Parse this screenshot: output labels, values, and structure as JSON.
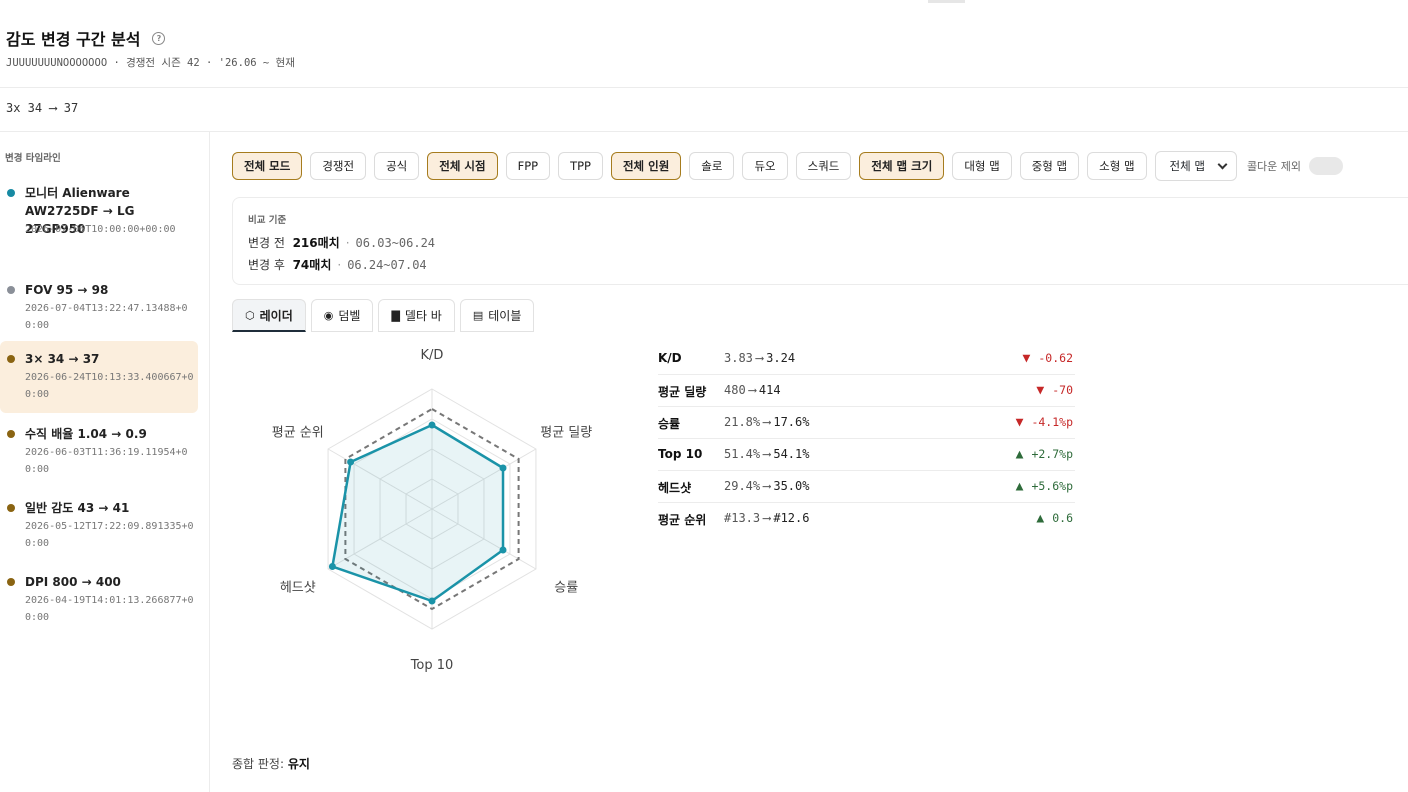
{
  "header": {
    "title": "감도 변경 구간 분석",
    "help_icon": "?",
    "subtitle": "JUUUUUUUNOOOOOOO · 경쟁전 시즌 42 · '26.06 ~ 현재"
  },
  "current": {
    "text": "3x 34 ⟶ 37"
  },
  "sidebar": {
    "title": "변경 타임라인",
    "items": [
      {
        "label": "모니터 Alienware AW2725DF → LG 27GP950",
        "timestamp": "2026-07-06T10:00:00+00:00",
        "color": "#178aa3"
      },
      {
        "label": "FOV 95 → 98",
        "timestamp": "2026-07-04T13:22:47.13488+00:00",
        "color": "#8a8f98"
      },
      {
        "label": "3× 34 → 37",
        "timestamp": "2026-06-24T10:13:33.400667+00:00",
        "color": "#8a6412",
        "active": true
      },
      {
        "label": "수직 배율 1.04 → 0.9",
        "timestamp": "2026-06-03T11:36:19.11954+00:00",
        "color": "#8a6412"
      },
      {
        "label": "일반 감도 43 → 41",
        "timestamp": "2026-05-12T17:22:09.891335+00:00",
        "color": "#8a6412"
      },
      {
        "label": "DPI 800 → 400",
        "timestamp": "2026-04-19T14:01:13.266877+00:00",
        "color": "#8a6412"
      }
    ]
  },
  "filters": {
    "chips": [
      {
        "label": "전체 모드",
        "on": true
      },
      {
        "label": "경쟁전",
        "on": false
      },
      {
        "label": "공식",
        "on": false
      },
      {
        "label": "전체 시점",
        "on": true
      },
      {
        "label": "FPP",
        "on": false
      },
      {
        "label": "TPP",
        "on": false
      },
      {
        "label": "전체 인원",
        "on": true
      },
      {
        "label": "솔로",
        "on": false
      },
      {
        "label": "듀오",
        "on": false
      },
      {
        "label": "스쿼드",
        "on": false
      },
      {
        "label": "전체 맵 크기",
        "on": true
      },
      {
        "label": "대형 맵",
        "on": false
      },
      {
        "label": "중형 맵",
        "on": false
      },
      {
        "label": "소형 맵",
        "on": false
      }
    ],
    "map_select": "전체 맵",
    "toggle_label": "콜다운 제외"
  },
  "baseline": {
    "title": "비교 기준",
    "before_label": "변경 전",
    "before_matches": "216매치",
    "before_range": "06.03~06.24",
    "after_label": "변경 후",
    "after_matches": "74매치",
    "after_range": "06.24~07.04"
  },
  "tabs": [
    {
      "label": "레이더",
      "icon": "hexagon-icon",
      "on": true
    },
    {
      "label": "덤벨",
      "icon": "dumbbell-icon",
      "on": false
    },
    {
      "label": "델타 바",
      "icon": "bar-icon",
      "on": false
    },
    {
      "label": "테이블",
      "icon": "table-icon",
      "on": false
    }
  ],
  "chart_data": {
    "type": "radar",
    "axes": [
      "K/D",
      "평균 딜량",
      "승률",
      "Top 10",
      "헤드샷",
      "평균 순위"
    ],
    "series": [
      {
        "values": [
          0.84,
          0.82,
          0.82,
          0.92,
          1.15,
          0.94
        ],
        "color": "#1a93a8",
        "style": "solid"
      },
      {
        "values": [
          1.0,
          1.0,
          1.0,
          1.0,
          1.0,
          1.0
        ],
        "color": "#777777",
        "style": "dashed"
      }
    ],
    "range": [
      0,
      1.2
    ],
    "grid_levels": 4
  },
  "metrics": [
    {
      "name": "K/D",
      "before": "3.83",
      "after": "3.24",
      "delta": "-0.62",
      "dir": "down"
    },
    {
      "name": "평균 딜량",
      "before": "480",
      "after": "414",
      "delta": "-70",
      "dir": "down"
    },
    {
      "name": "승률",
      "before": "21.8%",
      "after": "17.6%",
      "delta": "-4.1%p",
      "dir": "down"
    },
    {
      "name": "Top 10",
      "before": "51.4%",
      "after": "54.1%",
      "delta": "+2.7%p",
      "dir": "up"
    },
    {
      "name": "헤드샷",
      "before": "29.4%",
      "after": "35.0%",
      "delta": "+5.6%p",
      "dir": "up"
    },
    {
      "name": "평균 순위",
      "before": "#13.3",
      "after": "#12.6",
      "delta": "0.6",
      "dir": "up"
    }
  ],
  "metrics_arrow": "⟶",
  "verdict": {
    "label": "종합 판정:",
    "value": "유지"
  }
}
